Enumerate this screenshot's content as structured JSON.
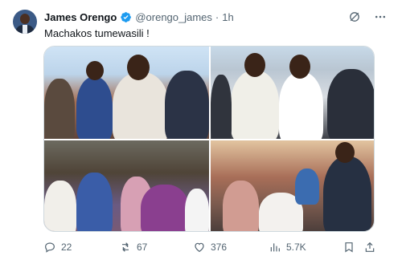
{
  "author": {
    "name": "James Orengo",
    "handle": "@orengo_james",
    "separator": "·",
    "time": "1h"
  },
  "tweet": {
    "text": "Machakos tumewasili !"
  },
  "media": {
    "photos": [
      "rally-crowd-photo",
      "handshake-crowd-photo",
      "crowd-meeting-photo",
      "indoor-meeting-photo"
    ]
  },
  "actions": {
    "replies": "22",
    "reposts": "67",
    "likes": "376",
    "views": "5.7K"
  },
  "colors": {
    "verified_blue": "#1d9bf0",
    "muted_text": "#536471",
    "text": "#0f1419"
  }
}
